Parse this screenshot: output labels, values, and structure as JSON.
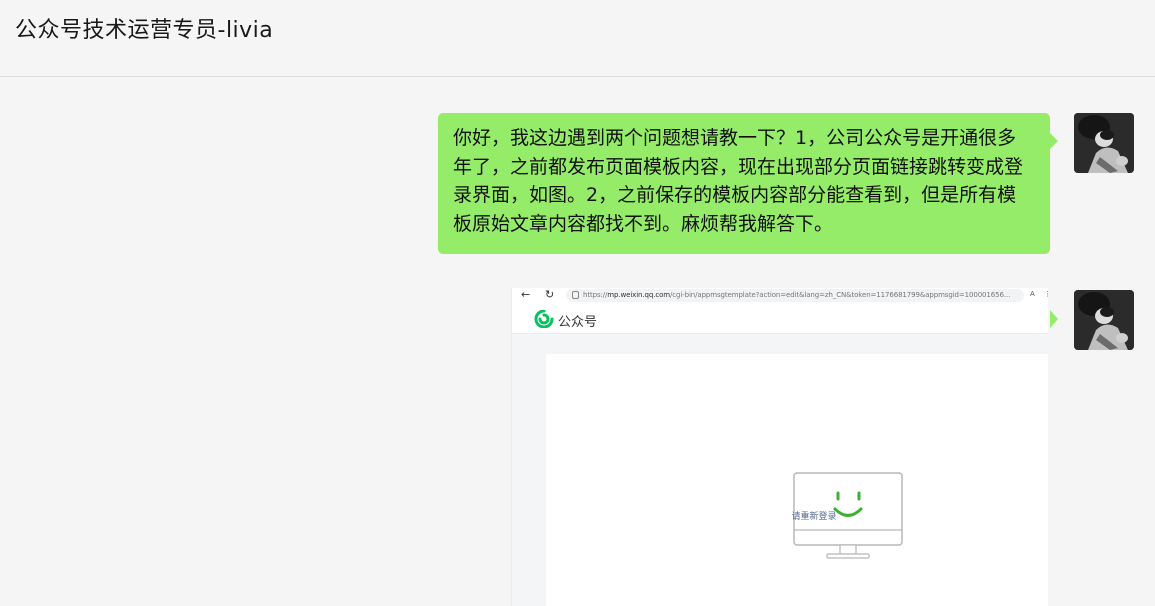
{
  "header": {
    "title": "公众号技术运营专员-livia"
  },
  "messages": [
    {
      "type": "text",
      "text": "你好，我这边遇到两个问题想请教一下？1，公司公众号是开通很多年了，之前都发布页面模板内容，现在出现部分页面链接跳转变成登录界面，如图。2，之前保存的模板内容部分能查看到，但是所有模板原始文章内容都找不到。麻烦帮我解答下。"
    },
    {
      "type": "image",
      "screenshot": {
        "url_scheme": "https://",
        "url_host": "mp.weixin.qq.com",
        "url_path": "/cgi-bin/appmsgtemplate?action=edit&lang=zh_CN&token=1176681799&appmsgid=100001656...",
        "reader_mode": "A",
        "app_title": "公众号",
        "relogin_prefix": "请重新",
        "relogin_link": "登录"
      }
    }
  ],
  "colors": {
    "bubble": "#95ec69",
    "background": "#f5f5f5",
    "wechat_green": "#07c160",
    "link": "#576b95"
  },
  "icons": [
    "back-arrow-icon",
    "reload-icon",
    "lock-icon",
    "wechat-mp-logo-icon",
    "smiley-monitor-icon",
    "user-avatar"
  ]
}
